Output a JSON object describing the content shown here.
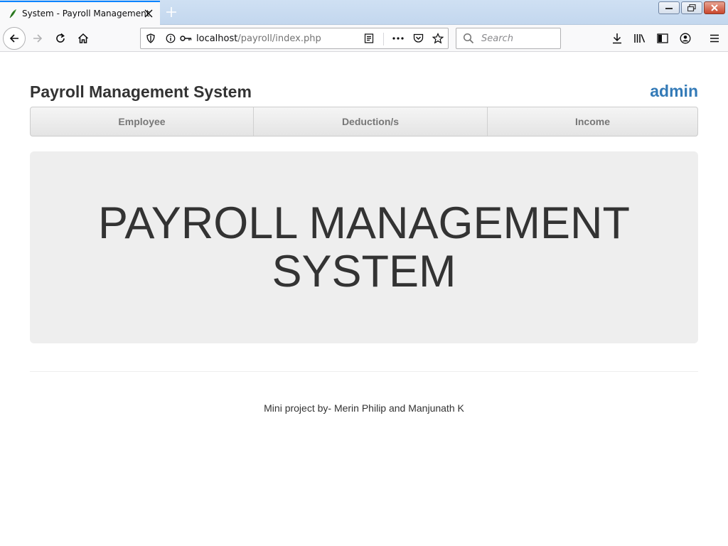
{
  "browser": {
    "tab_title": "System - Payroll Management",
    "url_host": "localhost",
    "url_path": "/payroll/index.php",
    "search_placeholder": "Search",
    "accent_color": "#0a84ff"
  },
  "header": {
    "brand": "Payroll Management System",
    "user": "admin",
    "user_color": "#337ab7"
  },
  "menu": {
    "items": [
      {
        "label": "Employee"
      },
      {
        "label": "Deduction/s"
      },
      {
        "label": "Income"
      }
    ]
  },
  "hero": {
    "title": "PAYROLL MANAGEMENT SYSTEM"
  },
  "footer": {
    "text": "Mini project by- Merin Philip and Manjunath K"
  }
}
